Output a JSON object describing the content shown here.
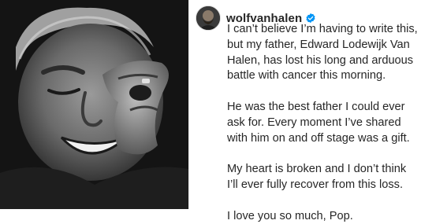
{
  "post": {
    "username": "wolfvanhalen",
    "verified_icon": "verified-badge-icon",
    "paragraphs": [
      "I can’t believe I’m having to write this, but my father, Edward Lodewijk Van Halen, has lost his long and arduous battle with cancer this morning.",
      "He was the best father I could ever ask for. Every moment I’ve shared with him on and off stage was a gift.",
      "My heart is broken and I don’t think I’ll ever fully recover from this loss.",
      "I love you so much, Pop."
    ]
  },
  "colors": {
    "verified_badge": "#0095f6",
    "text": "#262626"
  }
}
